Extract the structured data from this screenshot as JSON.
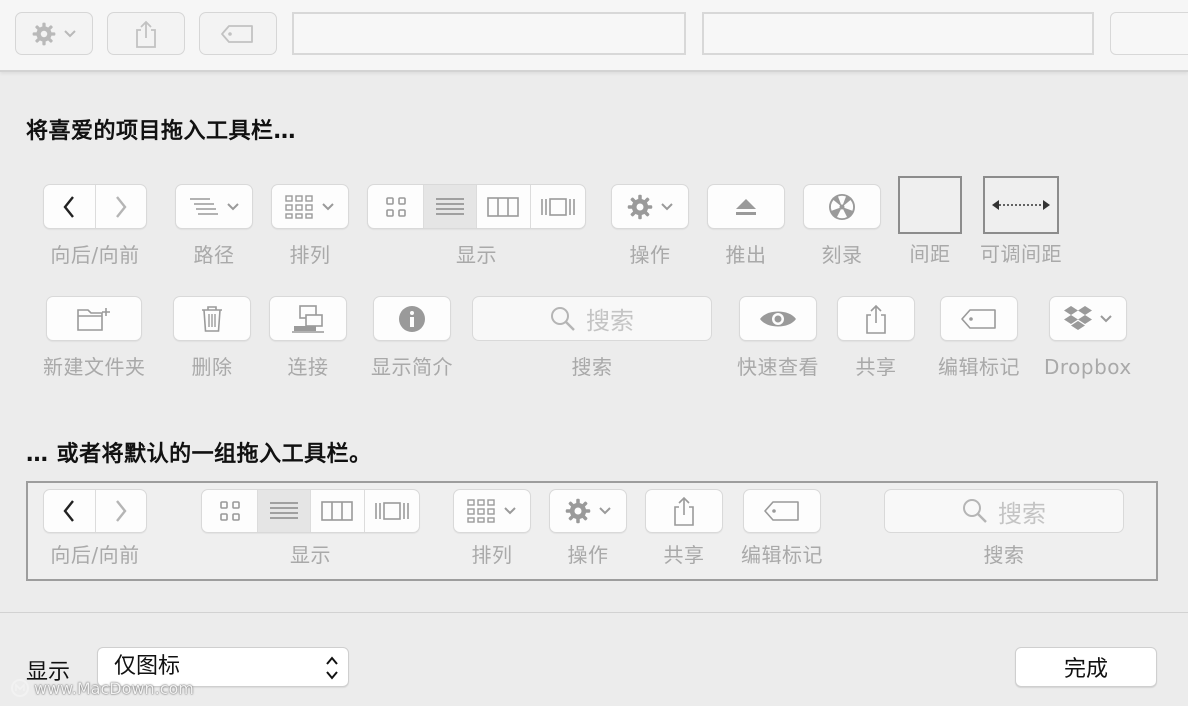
{
  "heading_favorites": "将喜爱的项目拖入工具栏…",
  "heading_default": "… 或者将默认的一组拖入工具栏。",
  "favorites_row1": {
    "back_forward": "向后/向前",
    "path": "路径",
    "arrange": "排列",
    "view": "显示",
    "action": "操作",
    "eject": "推出",
    "burn": "刻录",
    "space": "间距",
    "flexible_space": "可调间距"
  },
  "favorites_row2": {
    "new_folder": "新建文件夹",
    "delete": "删除",
    "connect": "连接",
    "get_info": "显示简介",
    "search": "搜索",
    "search_placeholder": "搜索",
    "quick_look": "快速查看",
    "share": "共享",
    "edit_tags": "编辑标记",
    "dropbox": "Dropbox"
  },
  "default_set": {
    "back_forward": "向后/向前",
    "view": "显示",
    "arrange": "排列",
    "action": "操作",
    "share": "共享",
    "edit_tags": "编辑标记",
    "search": "搜索",
    "search_placeholder": "搜索"
  },
  "footer": {
    "show_label": "显示",
    "show_value": "仅图标",
    "done_label": "完成"
  },
  "watermark": "www.MacDown.com",
  "colors": {
    "background": "#ececec",
    "label_gray": "#a9a9a9",
    "icon_gray": "#9a9a9a"
  }
}
